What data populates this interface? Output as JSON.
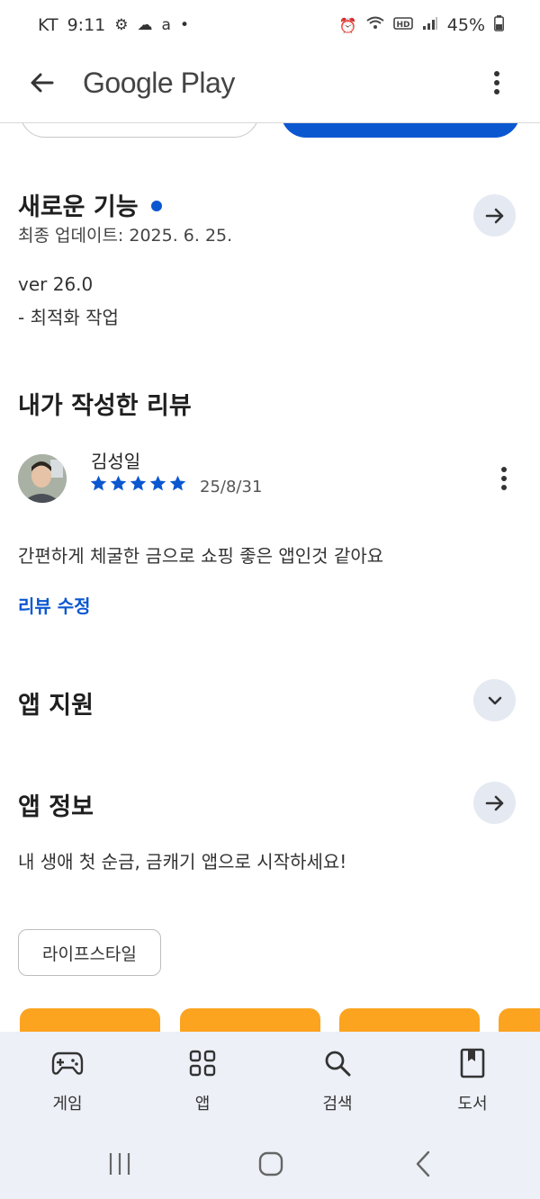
{
  "status_bar": {
    "carrier": "KT",
    "time": "9:11",
    "battery": "45%"
  },
  "app_bar": {
    "title": "Google Play"
  },
  "whats_new": {
    "title": "새로운 기능",
    "updated": "최종 업데이트: 2025. 6. 25.",
    "version": "ver 26.0",
    "note": "- 최적화 작업"
  },
  "my_review": {
    "title": "내가 작성한 리뷰",
    "reviewer": "김성일",
    "rating": 5,
    "date": "25/8/31",
    "text": "간편하게 체굴한 금으로 쇼핑 좋은 앱인것 같아요",
    "edit_label": "리뷰 수정"
  },
  "app_support": {
    "title": "앱 지원"
  },
  "app_info": {
    "title": "앱 정보",
    "description": "내 생애 첫 순금, 금캐기 앱으로 시작하세요!",
    "category_chip": "라이프스타일"
  },
  "bottom_nav": {
    "items": [
      {
        "label": "게임",
        "icon": "gamepad-icon"
      },
      {
        "label": "앱",
        "icon": "apps-grid-icon"
      },
      {
        "label": "검색",
        "icon": "search-icon"
      },
      {
        "label": "도서",
        "icon": "book-icon"
      }
    ]
  },
  "colors": {
    "accent": "#0b57d0",
    "round_button_bg": "#e5e9f2",
    "nav_bg": "#edf0f7",
    "promo_card": "#fca320",
    "star": "#0b57d0"
  }
}
